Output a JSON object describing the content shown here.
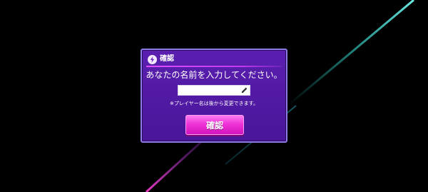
{
  "dialog": {
    "title": "確認",
    "prompt": "あなたの名前を入力してください。",
    "name_field": {
      "value": "",
      "placeholder": ""
    },
    "note": "※プレイヤー名は後から変更できます。",
    "confirm_label": "確認"
  },
  "colors": {
    "background": "#000000",
    "dialog_fill": "#5a1fb0",
    "dialog_border": "#8e7ae6",
    "accent_pink": "#f033d8",
    "beam_cyan": "#38e0d4",
    "beam_magenta": "#e23ad0"
  },
  "icons": {
    "header": "lightning-bolt-icon",
    "field": "pencil-icon"
  }
}
